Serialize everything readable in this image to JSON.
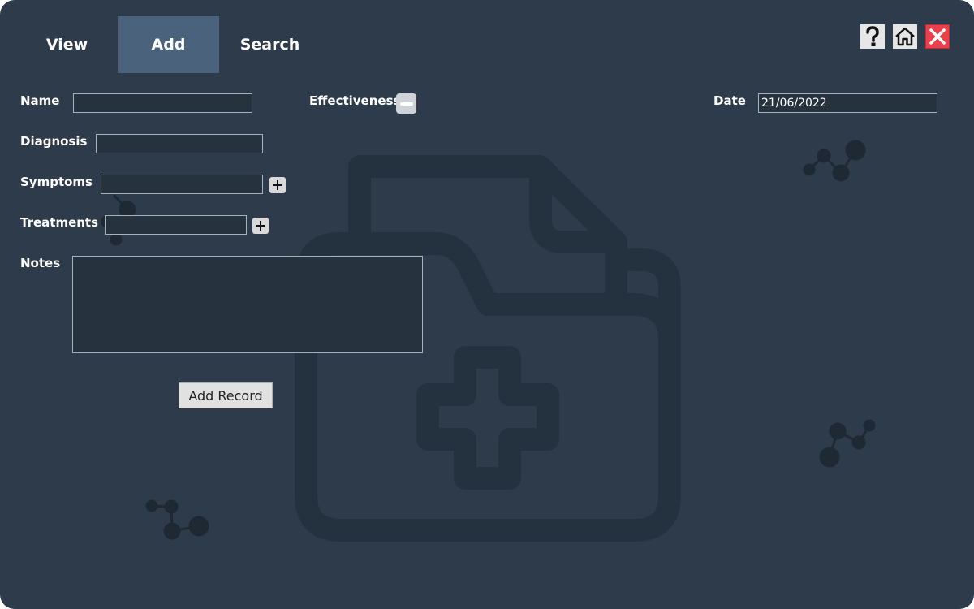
{
  "tabs": [
    {
      "label": "View",
      "active": false
    },
    {
      "label": "Add",
      "active": true
    },
    {
      "label": "Search",
      "active": false
    }
  ],
  "toolbar": {
    "help_icon": "question-mark-icon",
    "home_icon": "home-icon",
    "close_icon": "close-icon"
  },
  "form": {
    "name_label": "Name",
    "name_value": "",
    "diagnosis_label": "Diagnosis",
    "diagnosis_value": "",
    "symptoms_label": "Symptoms",
    "symptoms_value": "",
    "treatments_label": "Treatments",
    "treatments_value": "",
    "notes_label": "Notes",
    "notes_value": "",
    "effectiveness_label": "Effectiveness",
    "date_label": "Date",
    "date_value": "21/06/2022",
    "add_button": "Add Record"
  },
  "colors": {
    "background": "#2d3b4b",
    "active_tab": "#4b627c",
    "field_bg": "#26333f",
    "close_red": "#e8414b"
  }
}
